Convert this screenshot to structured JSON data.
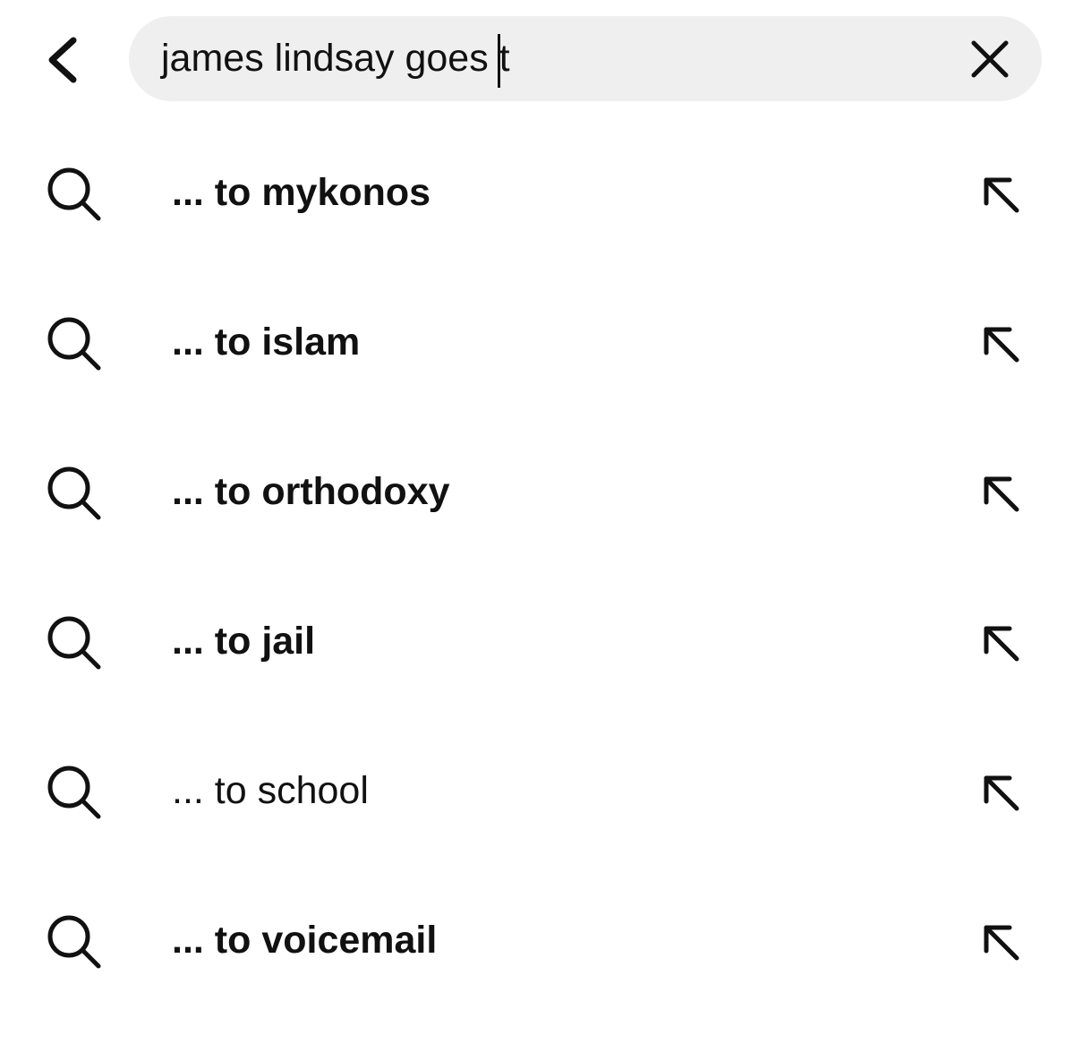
{
  "search": {
    "query": "james lindsay goes t",
    "back_icon": "chevron-left-icon",
    "clear_icon": "close-icon"
  },
  "suggestions": [
    {
      "label": "... to mykonos",
      "bold": true
    },
    {
      "label": "... to islam",
      "bold": true
    },
    {
      "label": "... to orthodoxy",
      "bold": true
    },
    {
      "label": "... to jail",
      "bold": true
    },
    {
      "label": "... to school",
      "bold": false
    },
    {
      "label": "... to voicemail",
      "bold": true
    }
  ],
  "icons": {
    "suggestion_leading": "search-icon",
    "suggestion_trailing": "arrow-up-left-icon"
  },
  "colors": {
    "background": "#ffffff",
    "search_field": "#efefef",
    "text": "#111111"
  }
}
